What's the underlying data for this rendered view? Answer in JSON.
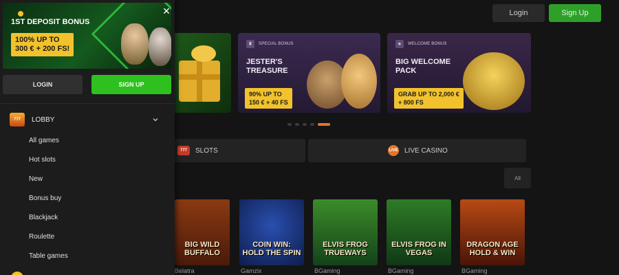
{
  "header": {
    "login_label": "Login",
    "signup_label": "Sign Up"
  },
  "banners": [
    {
      "tag": "",
      "title": "",
      "offer": ""
    },
    {
      "tag": "SPECIAL BONUS",
      "title": "JESTER'S TREASURE",
      "offer_line1": "90% UP TO",
      "offer_line2": "150 € + 40 FS"
    },
    {
      "tag": "WELCOME BONUS",
      "title": "BIG WELCOME PACK",
      "offer_line1": "GRAB UP TO 2,000 €",
      "offer_line2": "+ 800 FS"
    }
  ],
  "carousel": {
    "count": 5,
    "active_index": 4
  },
  "categories": [
    {
      "label": "SLOTS",
      "icon": "slots-777-icon",
      "icon_text": "777"
    },
    {
      "label": "LIVE CASINO",
      "icon": "live-casino-icon",
      "icon_text": "LIVE"
    }
  ],
  "filter": {
    "label": "All"
  },
  "games": [
    {
      "title": "BIG WILD BUFFALO",
      "provider": "Belatra"
    },
    {
      "title": "COIN WIN: HOLD THE SPIN",
      "provider": "Gamzix"
    },
    {
      "title": "ELVIS FROG TRUEWAYS",
      "provider": "BGaming"
    },
    {
      "title": "ELVIS FROG IN VEGAS",
      "provider": "BGaming"
    },
    {
      "title": "DRAGON AGE HOLD & WIN",
      "provider": "BGaming"
    }
  ],
  "sidebar": {
    "promo_title": "1ST DEPOSIT BONUS",
    "promo_offer_line1": "100% UP TO",
    "promo_offer_line2": "300 € + 200 FS!",
    "close_label": "✕",
    "login_label": "LOGIN",
    "signup_label": "SIGN UP",
    "lobby_label": "LOBBY",
    "lobby_icon_text": "777",
    "menu": [
      "All games",
      "Hot slots",
      "New",
      "Bonus buy",
      "Blackjack",
      "Roulette",
      "Table games"
    ]
  },
  "colors": {
    "accent_green": "#2ec01f",
    "promo_yellow": "#f2c22d",
    "carousel_active": "#e0762c",
    "background": "#141414"
  }
}
